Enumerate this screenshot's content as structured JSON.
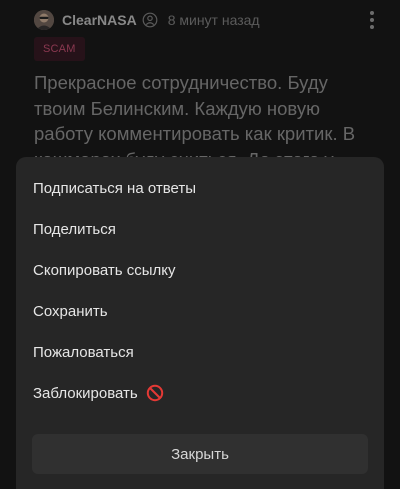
{
  "post": {
    "author": "ClearNASA",
    "time": "8 минут назад",
    "badge": "SCAM",
    "text": "Прекрасное сотрудничество. Буду твоим Белинским. Каждую новую работу комментировать как критик. В кошмарах буду сниться. До этого у тебя не было"
  },
  "menu": {
    "items": [
      {
        "label": "Подписаться на ответы"
      },
      {
        "label": "Поделиться"
      },
      {
        "label": "Скопировать ссылку"
      },
      {
        "label": "Сохранить"
      },
      {
        "label": "Пожаловаться"
      },
      {
        "label": "Заблокировать",
        "icon": "ban-icon"
      }
    ],
    "close_label": "Закрыть"
  },
  "colors": {
    "background": "#1c1c1c",
    "sheet": "#262626",
    "badge_text": "#d1557a",
    "badge_bg": "#3a1c26",
    "ban_icon": "#e53935"
  }
}
